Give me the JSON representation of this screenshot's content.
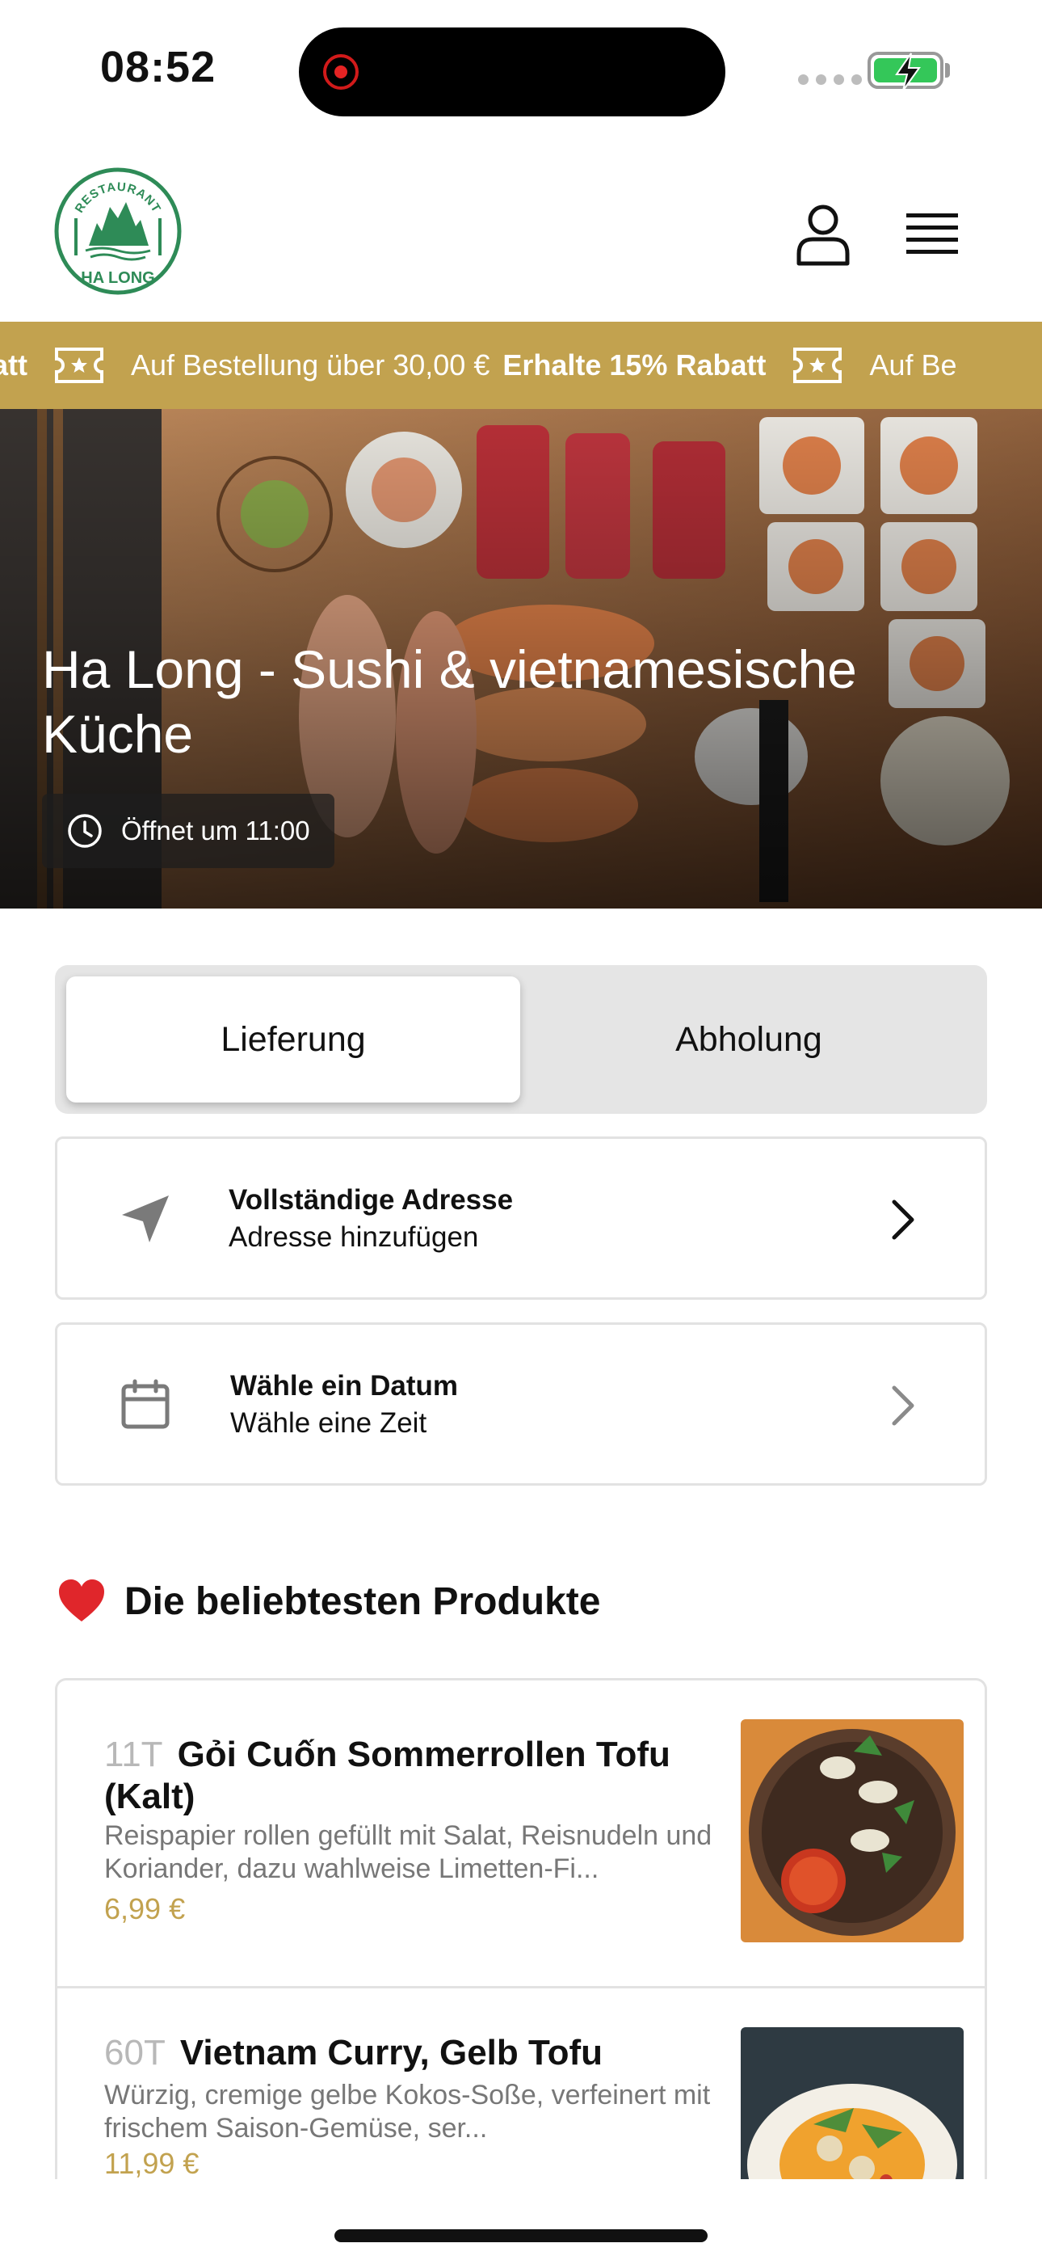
{
  "status_bar": {
    "time": "08:52"
  },
  "header": {
    "logo_text_top": "RESTAURANT",
    "logo_text_bottom": "HA LONG"
  },
  "promo": {
    "lead_fragment": "Rabatt",
    "normal": "Auf Bestellung über 30,00 €",
    "bold": "Erhalte 15% Rabatt",
    "trail_fragment": "Auf Be"
  },
  "hero": {
    "title": "Ha Long - Sushi & vietnamesische Küche",
    "opening": "Öffnet um 11:00"
  },
  "mode_tabs": {
    "delivery": "Lieferung",
    "pickup": "Abholung",
    "selected": "Lieferung"
  },
  "address_card": {
    "title": "Vollständige Adresse",
    "subtitle": "Adresse hinzufügen"
  },
  "date_card": {
    "title": "Wähle ein Datum",
    "subtitle": "Wähle eine Zeit"
  },
  "popular": {
    "title": "Die beliebtesten Produkte",
    "products": [
      {
        "code": "11T",
        "name": "Gỏi Cuốn Sommerrollen Tofu (Kalt)",
        "description": "Reispapier rollen gefüllt mit Salat, Reisnudeln und Koriander, dazu wahlweise Limetten-Fi...",
        "price": "6,99 €"
      },
      {
        "code": "60T",
        "name": "Vietnam Curry, Gelb Tofu",
        "description": "Würzig, cremige gelbe Kokos-Soße, verfeinert mit frischem Saison-Gemüse, ser...",
        "price": "11,99 €"
      }
    ]
  },
  "colors": {
    "accent_gold": "#c2a24f",
    "logo_green": "#2e8b57",
    "battery_green": "#34c759",
    "record_red": "#e52323"
  }
}
